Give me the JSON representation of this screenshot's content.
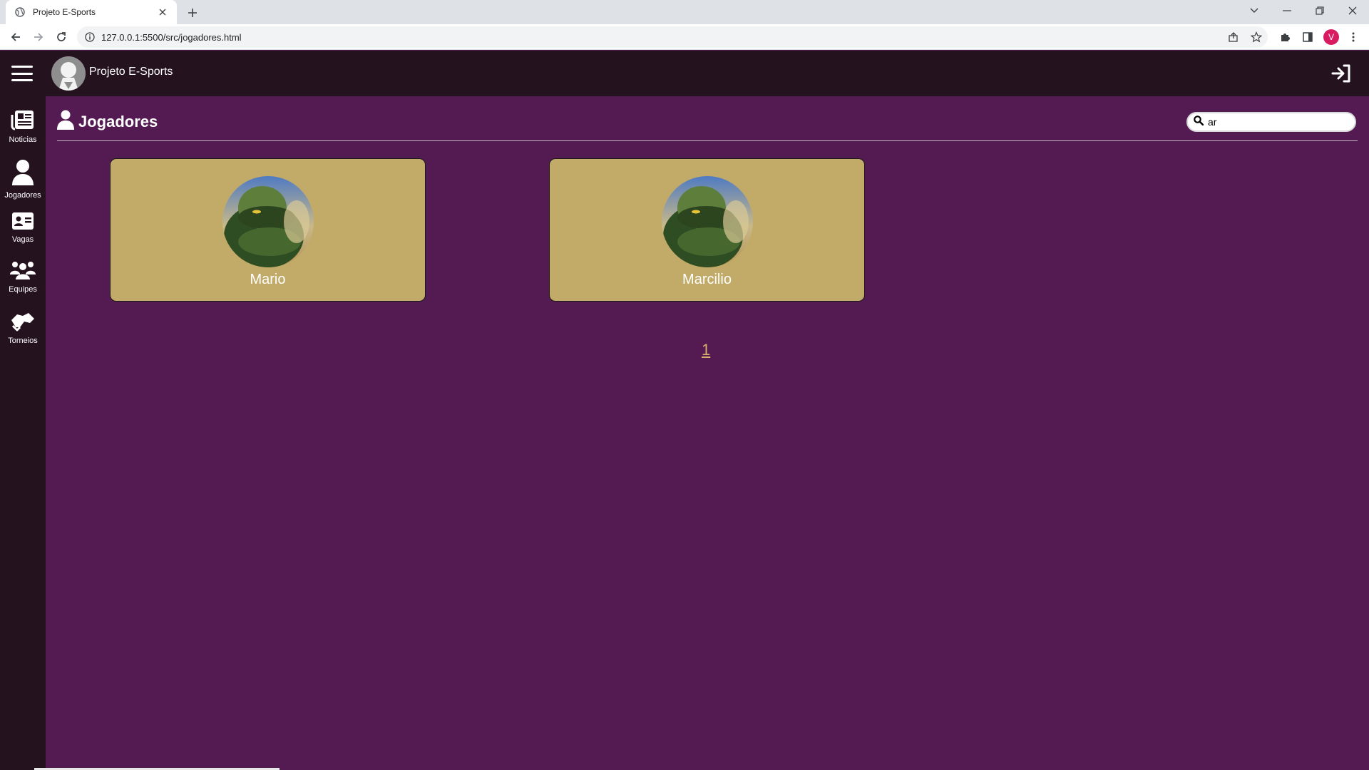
{
  "browser": {
    "tab_title": "Projeto E-Sports",
    "url": "127.0.0.1:5500/src/jogadores.html",
    "profile_initial": "V"
  },
  "app": {
    "brand": "Projeto E-Sports"
  },
  "sidebar": {
    "items": [
      {
        "label": "Noticias",
        "icon": "newspaper-icon"
      },
      {
        "label": "Jogadores",
        "icon": "user-icon"
      },
      {
        "label": "Vagas",
        "icon": "id-card-icon"
      },
      {
        "label": "Equipes",
        "icon": "users-icon"
      },
      {
        "label": "Torneios",
        "icon": "handshake-icon"
      }
    ]
  },
  "page": {
    "title": "Jogadores",
    "search_value": "ar"
  },
  "players": [
    {
      "name": "Mario"
    },
    {
      "name": "Marcilio"
    }
  ],
  "pagination": {
    "current": "1"
  },
  "colors": {
    "page_bg": "#531b52",
    "header_bg": "#24121f",
    "card_bg": "#c2aa68",
    "pagination_link": "#d9b06a"
  }
}
